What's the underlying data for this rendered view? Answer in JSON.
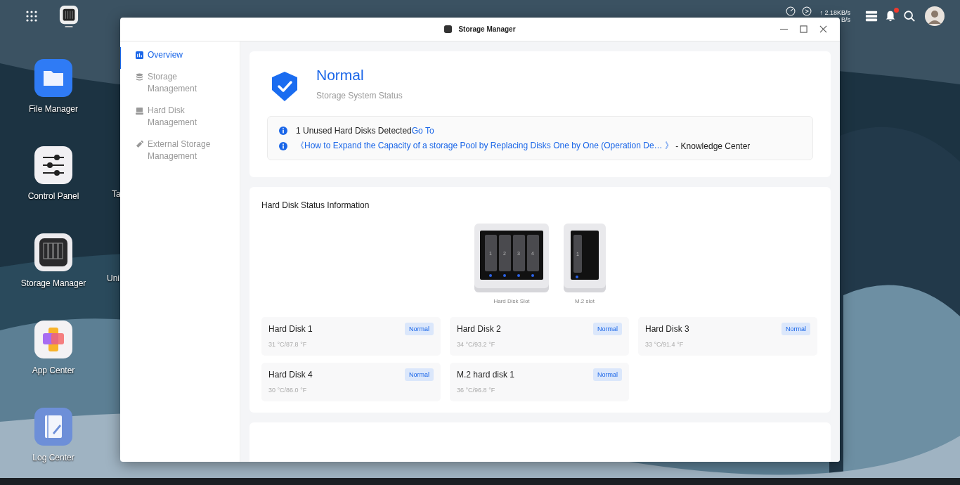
{
  "top_bar": {
    "upload_speed": "↑ 2.18KB/s",
    "download_speed": "B/s",
    "notification_unread": true
  },
  "desktop": {
    "apps": [
      {
        "label": "File Manager",
        "kind": "folder"
      },
      {
        "label": "Control Panel",
        "kind": "sliders"
      },
      {
        "label": "Storage Manager",
        "kind": "storage"
      },
      {
        "label": "App Center",
        "kind": "apps"
      },
      {
        "label": "Log Center",
        "kind": "log"
      }
    ],
    "cut_labels": [
      {
        "label": "Ta"
      },
      {
        "label": "Uni"
      }
    ]
  },
  "window": {
    "title": "Storage Manager"
  },
  "sidebar": {
    "items": [
      {
        "label": "Overview",
        "selected": true,
        "kind": "overview"
      },
      {
        "label": "Storage Management",
        "selected": false,
        "kind": "stack"
      },
      {
        "label": "Hard Disk Management",
        "selected": false,
        "kind": "disk"
      },
      {
        "label": "External Storage Management",
        "selected": false,
        "kind": "usb"
      }
    ]
  },
  "status": {
    "state": "Normal",
    "caption": "Storage System Status"
  },
  "notices": [
    {
      "parts": [
        {
          "kind": "plain",
          "text": "1 Unused Hard Disks Detected"
        },
        {
          "kind": "link",
          "text": "Go To"
        }
      ]
    },
    {
      "parts": [
        {
          "kind": "link",
          "text": "《How to Expand the Capacity of a storage Pool by Replacing Disks One by One (Operation De… 》"
        },
        {
          "kind": "plain",
          "text": " - Knowledge Center"
        }
      ]
    }
  ],
  "disk_section": {
    "title": "Hard Disk Status Information",
    "slots": [
      {
        "label": "Hard Disk Slot",
        "kind": "bays",
        "bays": [
          "1",
          "2",
          "3",
          "4"
        ]
      },
      {
        "label": "M.2 slot",
        "kind": "m2",
        "bays": [
          "1"
        ]
      }
    ],
    "disks": [
      {
        "name": "Hard Disk 1",
        "status": "Normal",
        "temperature": "31 °C/87.8 °F"
      },
      {
        "name": "Hard Disk 2",
        "status": "Normal",
        "temperature": "34 °C/93.2 °F"
      },
      {
        "name": "Hard Disk 3",
        "status": "Normal",
        "temperature": "33 °C/91.4 °F"
      },
      {
        "name": "Hard Disk 4",
        "status": "Normal",
        "temperature": "30 °C/86.0 °F"
      },
      {
        "name": "M.2 hard disk 1",
        "status": "Normal",
        "temperature": "36 °C/96.8 °F"
      }
    ]
  }
}
